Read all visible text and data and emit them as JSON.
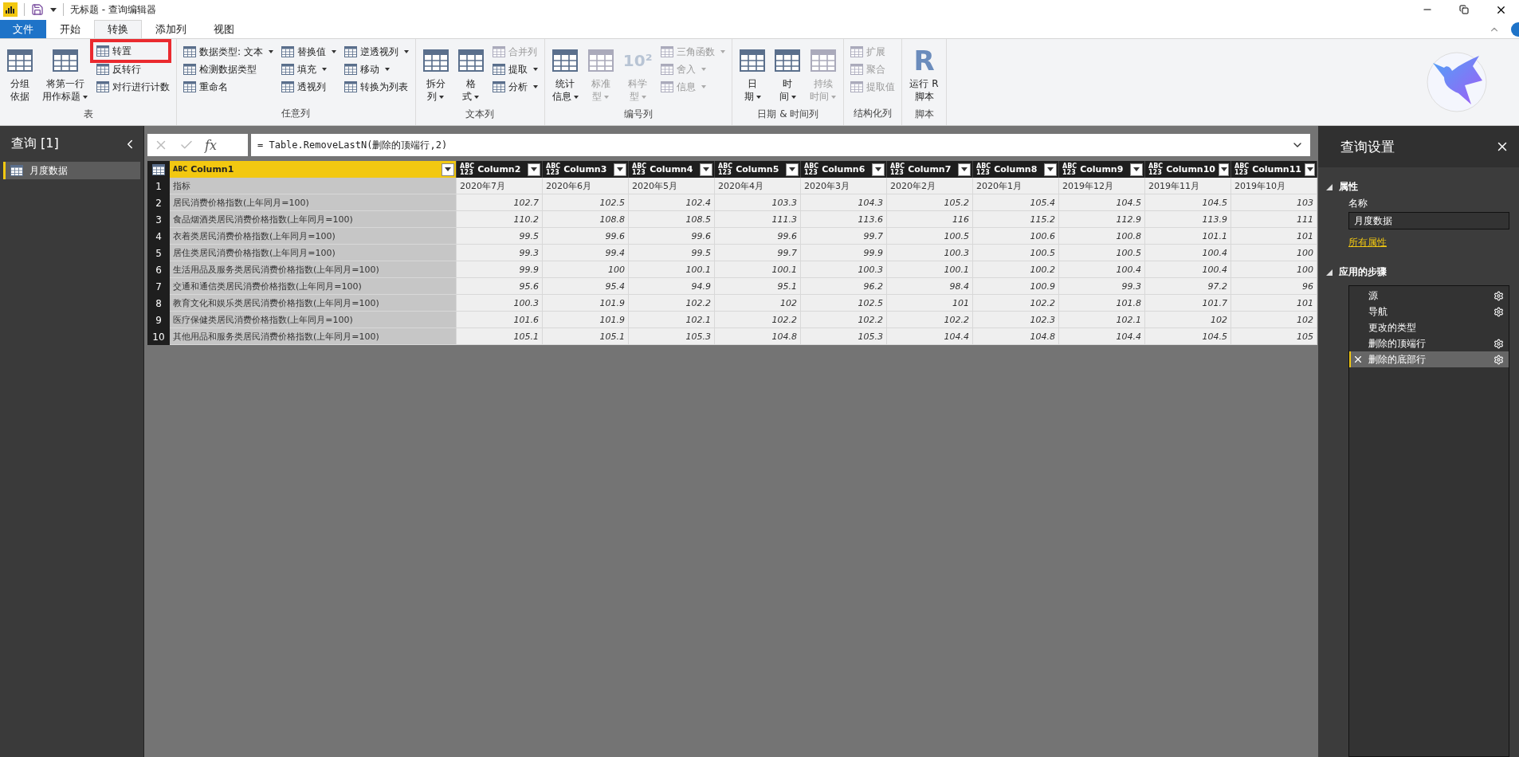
{
  "title_bar": {
    "title": "无标题 - 查询编辑器"
  },
  "menu_tabs": [
    {
      "label": "文件",
      "kind": "file",
      "selected": false
    },
    {
      "label": "开始",
      "kind": "tab",
      "selected": false
    },
    {
      "label": "转换",
      "kind": "tab",
      "selected": true
    },
    {
      "label": "添加列",
      "kind": "tab",
      "selected": false
    },
    {
      "label": "视图",
      "kind": "tab",
      "selected": false
    }
  ],
  "ribbon_groups": [
    {
      "label": "表",
      "columns": [
        {
          "kind": "large",
          "lines": [
            "分组",
            "依据"
          ],
          "dropdown": false,
          "disabled": false
        },
        {
          "kind": "large",
          "lines": [
            "将第一行",
            "用作标题"
          ],
          "dropdown": true,
          "disabled": false
        },
        {
          "kind": "stack",
          "items": [
            {
              "label": "转置",
              "dropdown": false,
              "disabled": false,
              "highlighted": true
            },
            {
              "label": "反转行",
              "dropdown": false,
              "disabled": false,
              "highlighted": false
            },
            {
              "label": "对行进行计数",
              "dropdown": false,
              "disabled": false,
              "highlighted": false
            }
          ]
        }
      ]
    },
    {
      "label": "任意列",
      "columns": [
        {
          "kind": "stack",
          "items": [
            {
              "label": "数据类型: 文本",
              "dropdown": true,
              "disabled": false,
              "highlighted": false
            },
            {
              "label": "检测数据类型",
              "dropdown": false,
              "disabled": false,
              "highlighted": false
            },
            {
              "label": "重命名",
              "dropdown": false,
              "disabled": false,
              "highlighted": false
            }
          ]
        },
        {
          "kind": "stack",
          "items": [
            {
              "label": "替换值",
              "dropdown": true,
              "disabled": false,
              "highlighted": false
            },
            {
              "label": "填充",
              "dropdown": true,
              "disabled": false,
              "highlighted": false
            },
            {
              "label": "透视列",
              "dropdown": false,
              "disabled": false,
              "highlighted": false
            }
          ]
        },
        {
          "kind": "stack",
          "items": [
            {
              "label": "逆透视列",
              "dropdown": true,
              "disabled": false,
              "highlighted": false
            },
            {
              "label": "移动",
              "dropdown": true,
              "disabled": false,
              "highlighted": false
            },
            {
              "label": "转换为列表",
              "dropdown": false,
              "disabled": false,
              "highlighted": false
            }
          ]
        }
      ]
    },
    {
      "label": "文本列",
      "columns": [
        {
          "kind": "large",
          "lines": [
            "拆分",
            "列"
          ],
          "dropdown": true,
          "disabled": false
        },
        {
          "kind": "large",
          "lines": [
            "格",
            "式"
          ],
          "dropdown": true,
          "disabled": false
        },
        {
          "kind": "stack",
          "items": [
            {
              "label": "合并列",
              "dropdown": false,
              "disabled": true,
              "highlighted": false
            },
            {
              "label": "提取",
              "dropdown": true,
              "disabled": false,
              "highlighted": false
            },
            {
              "label": "分析",
              "dropdown": true,
              "disabled": false,
              "highlighted": false
            }
          ]
        }
      ]
    },
    {
      "label": "编号列",
      "columns": [
        {
          "kind": "large",
          "lines": [
            "统计",
            "信息"
          ],
          "dropdown": true,
          "disabled": false
        },
        {
          "kind": "large",
          "lines": [
            "标准",
            "型"
          ],
          "dropdown": true,
          "disabled": true
        },
        {
          "kind": "large",
          "lines": [
            "科学",
            "型"
          ],
          "dropdown": true,
          "disabled": true,
          "glyph": "10²"
        },
        {
          "kind": "stack",
          "items": [
            {
              "label": "三角函数",
              "dropdown": true,
              "disabled": true,
              "highlighted": false
            },
            {
              "label": "舍入",
              "dropdown": true,
              "disabled": true,
              "highlighted": false
            },
            {
              "label": "信息",
              "dropdown": true,
              "disabled": true,
              "highlighted": false
            }
          ]
        }
      ]
    },
    {
      "label": "日期 & 时间列",
      "columns": [
        {
          "kind": "large",
          "lines": [
            "日",
            "期"
          ],
          "dropdown": true,
          "disabled": false
        },
        {
          "kind": "large",
          "lines": [
            "时",
            "间"
          ],
          "dropdown": true,
          "disabled": false
        },
        {
          "kind": "large",
          "lines": [
            "持续",
            "时间"
          ],
          "dropdown": true,
          "disabled": true
        }
      ]
    },
    {
      "label": "结构化列",
      "columns": [
        {
          "kind": "stack",
          "items": [
            {
              "label": "扩展",
              "dropdown": false,
              "disabled": true,
              "highlighted": false
            },
            {
              "label": "聚合",
              "dropdown": false,
              "disabled": true,
              "highlighted": false
            },
            {
              "label": "提取值",
              "dropdown": false,
              "disabled": true,
              "highlighted": false
            }
          ]
        }
      ]
    },
    {
      "label": "脚本",
      "columns": [
        {
          "kind": "large",
          "lines": [
            "运行 R",
            "脚本"
          ],
          "dropdown": false,
          "disabled": false,
          "glyph": "R"
        }
      ]
    }
  ],
  "queries_panel": {
    "title": "查询 [1]",
    "items": [
      {
        "label": "月度数据",
        "selected": true
      }
    ]
  },
  "formula_bar": {
    "fx": "fx",
    "formula": "= Table.RemoveLastN(删除的顶端行,2)"
  },
  "table": {
    "columns": [
      {
        "name": "Column1",
        "type_glyph": [
          "ABC"
        ],
        "selected": true
      },
      {
        "name": "Column2",
        "type_glyph": [
          "ABC",
          "123"
        ],
        "selected": false
      },
      {
        "name": "Column3",
        "type_glyph": [
          "ABC",
          "123"
        ],
        "selected": false
      },
      {
        "name": "Column4",
        "type_glyph": [
          "ABC",
          "123"
        ],
        "selected": false
      },
      {
        "name": "Column5",
        "type_glyph": [
          "ABC",
          "123"
        ],
        "selected": false
      },
      {
        "name": "Column6",
        "type_glyph": [
          "ABC",
          "123"
        ],
        "selected": false
      },
      {
        "name": "Column7",
        "type_glyph": [
          "ABC",
          "123"
        ],
        "selected": false
      },
      {
        "name": "Column8",
        "type_glyph": [
          "ABC",
          "123"
        ],
        "selected": false
      },
      {
        "name": "Column9",
        "type_glyph": [
          "ABC",
          "123"
        ],
        "selected": false
      },
      {
        "name": "Column10",
        "type_glyph": [
          "ABC",
          "123"
        ],
        "selected": false
      },
      {
        "name": "Column11",
        "type_glyph": [
          "ABC",
          "123"
        ],
        "selected": false
      }
    ],
    "rows": [
      {
        "num": "1",
        "kind": "text",
        "cells": [
          "指标",
          "2020年7月",
          "2020年6月",
          "2020年5月",
          "2020年4月",
          "2020年3月",
          "2020年2月",
          "2020年1月",
          "2019年12月",
          "2019年11月",
          "2019年10月"
        ]
      },
      {
        "num": "2",
        "kind": "number",
        "cells": [
          "居民消费价格指数(上年同月=100)",
          "102.7",
          "102.5",
          "102.4",
          "103.3",
          "104.3",
          "105.2",
          "105.4",
          "104.5",
          "104.5",
          "103"
        ]
      },
      {
        "num": "3",
        "kind": "number",
        "cells": [
          "食品烟酒类居民消费价格指数(上年同月=100)",
          "110.2",
          "108.8",
          "108.5",
          "111.3",
          "113.6",
          "116",
          "115.2",
          "112.9",
          "113.9",
          "111"
        ]
      },
      {
        "num": "4",
        "kind": "number",
        "cells": [
          "衣着类居民消费价格指数(上年同月=100)",
          "99.5",
          "99.6",
          "99.6",
          "99.6",
          "99.7",
          "100.5",
          "100.6",
          "100.8",
          "101.1",
          "101"
        ]
      },
      {
        "num": "5",
        "kind": "number",
        "cells": [
          "居住类居民消费价格指数(上年同月=100)",
          "99.3",
          "99.4",
          "99.5",
          "99.7",
          "99.9",
          "100.3",
          "100.5",
          "100.5",
          "100.4",
          "100"
        ]
      },
      {
        "num": "6",
        "kind": "number",
        "cells": [
          "生活用品及服务类居民消费价格指数(上年同月=100)",
          "99.9",
          "100",
          "100.1",
          "100.1",
          "100.3",
          "100.1",
          "100.2",
          "100.4",
          "100.4",
          "100"
        ]
      },
      {
        "num": "7",
        "kind": "number",
        "cells": [
          "交通和通信类居民消费价格指数(上年同月=100)",
          "95.6",
          "95.4",
          "94.9",
          "95.1",
          "96.2",
          "98.4",
          "100.9",
          "99.3",
          "97.2",
          "96"
        ]
      },
      {
        "num": "8",
        "kind": "number",
        "cells": [
          "教育文化和娱乐类居民消费价格指数(上年同月=100)",
          "100.3",
          "101.9",
          "102.2",
          "102",
          "102.5",
          "101",
          "102.2",
          "101.8",
          "101.7",
          "101"
        ]
      },
      {
        "num": "9",
        "kind": "number",
        "cells": [
          "医疗保健类居民消费价格指数(上年同月=100)",
          "101.6",
          "101.9",
          "102.1",
          "102.2",
          "102.2",
          "102.2",
          "102.3",
          "102.1",
          "102",
          "102"
        ]
      },
      {
        "num": "10",
        "kind": "number",
        "cells": [
          "其他用品和服务类居民消费价格指数(上年同月=100)",
          "105.1",
          "105.1",
          "105.3",
          "104.8",
          "105.3",
          "104.4",
          "104.8",
          "104.4",
          "104.5",
          "105"
        ]
      }
    ]
  },
  "settings_panel": {
    "title": "查询设置",
    "properties_heading": "属性",
    "name_label": "名称",
    "name_value": "月度数据",
    "all_properties_link": "所有属性",
    "steps_heading": "应用的步骤",
    "steps": [
      {
        "label": "源",
        "has_settings": true,
        "selected": false
      },
      {
        "label": "导航",
        "has_settings": true,
        "selected": false
      },
      {
        "label": "更改的类型",
        "has_settings": false,
        "selected": false
      },
      {
        "label": "删除的顶端行",
        "has_settings": true,
        "selected": false
      },
      {
        "label": "删除的底部行",
        "has_settings": true,
        "selected": true
      }
    ]
  }
}
